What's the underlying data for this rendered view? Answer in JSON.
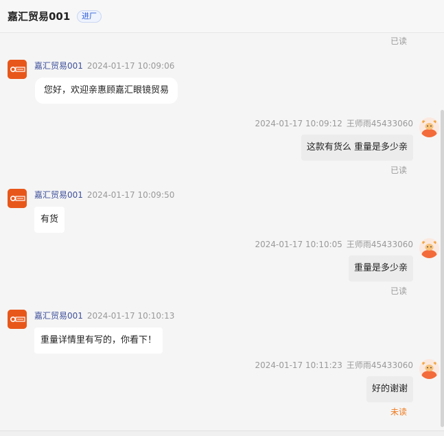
{
  "header": {
    "title": "嘉汇贸易001",
    "badge": "进厂"
  },
  "top_status": "已读",
  "messages": [
    {
      "side": "left",
      "sender": "嘉汇贸易001",
      "time": "2024-01-17 10:09:06",
      "text": "您好，欢迎亲惠顾嘉汇眼镜贸易"
    },
    {
      "side": "right",
      "sender": "王师雨45433060",
      "time": "2024-01-17 10:09:12",
      "text": "这款有货么  重量是多少亲",
      "status": "已读"
    },
    {
      "side": "left",
      "sender": "嘉汇贸易001",
      "time": "2024-01-17 10:09:50",
      "text": "有货"
    },
    {
      "side": "right",
      "sender": "王师雨45433060",
      "time": "2024-01-17 10:10:05",
      "text": "重量是多少亲",
      "status": "已读"
    },
    {
      "side": "left",
      "sender": "嘉汇贸易001",
      "time": "2024-01-17 10:10:13",
      "text": "重量详情里有写的，你看下！"
    },
    {
      "side": "right",
      "sender": "王师雨45433060",
      "time": "2024-01-17 10:11:23",
      "text": "好的谢谢",
      "status": "未读"
    }
  ],
  "colors": {
    "shop_avatar": "#e8571a",
    "unread": "#f07a1d",
    "badge_text": "#2b5bd7"
  },
  "icons": {
    "shop_avatar": "shop-logo-icon",
    "user_avatar": "cartoon-bull-avatar-icon"
  }
}
